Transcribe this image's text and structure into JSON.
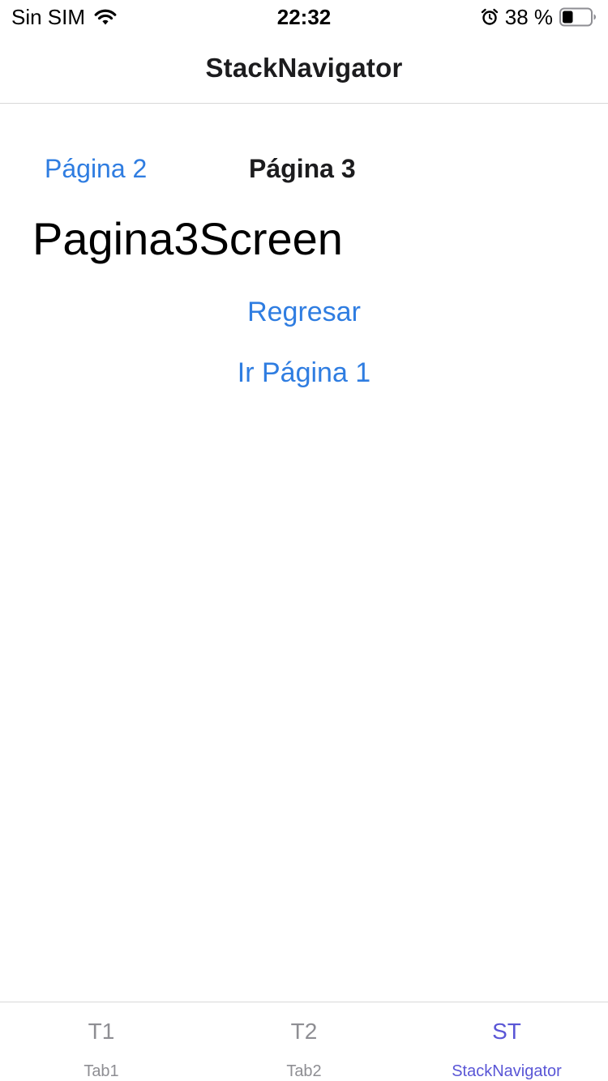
{
  "status_bar": {
    "carrier": "Sin SIM",
    "time": "22:32",
    "battery_percent": "38 %",
    "battery_level": 0.38,
    "icons": [
      "wifi-icon",
      "alarm-icon",
      "battery-icon"
    ]
  },
  "header": {
    "title": "StackNavigator"
  },
  "content": {
    "link_prev": "Página 2",
    "current_page": "Página 3",
    "screen_title": "Pagina3Screen",
    "btn_back": "Regresar",
    "btn_first": "Ir Página 1"
  },
  "tabs": [
    {
      "icon_text": "T1",
      "label": "Tab1",
      "active": false
    },
    {
      "icon_text": "T2",
      "label": "Tab2",
      "active": false
    },
    {
      "icon_text": "ST",
      "label": "StackNavigator",
      "active": true
    }
  ],
  "colors": {
    "link": "#2f7de1",
    "active_tab": "#5a56d6",
    "inactive_tab": "#8e8e93"
  }
}
